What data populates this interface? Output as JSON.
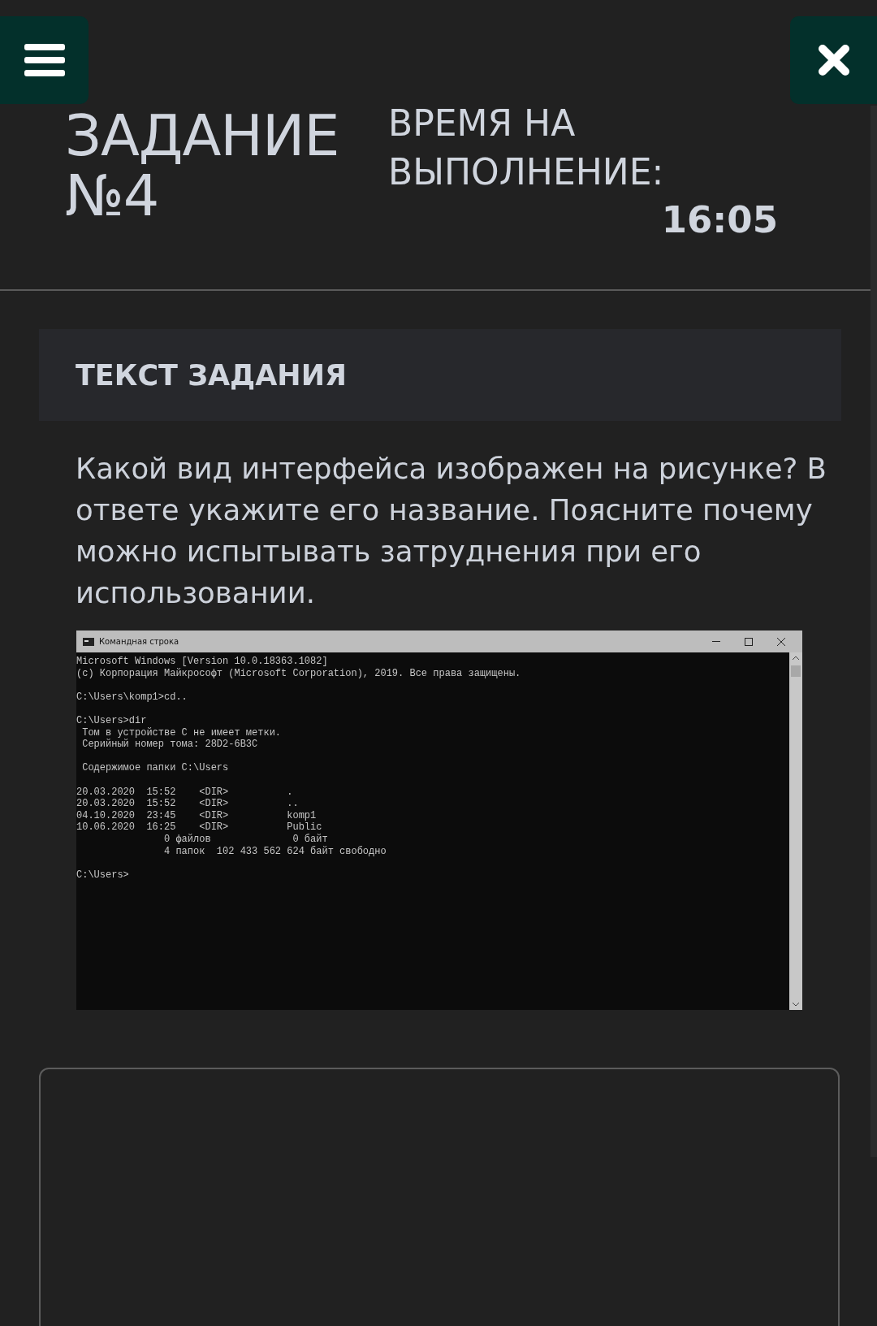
{
  "header": {
    "task_title": "ЗАДАНИЕ №4",
    "timer_label": "ВРЕМЯ НА ВЫПОЛНЕНИЕ:",
    "timer_value": "16:05"
  },
  "task": {
    "heading": "ТЕКСТ ЗАДАНИЯ",
    "question": "Какой вид интерфейса изображен на рисунке? В ответе укажите его название. Поясните почему можно испытывать затруднения при его использовании.",
    "screenshot": {
      "title": "Командная строка",
      "blocks": [
        [
          "Microsoft Windows [Version 10.0.18363.1082]",
          "(c) Корпорация Майкрософт (Microsoft Corporation), 2019. Все права защищены."
        ],
        [
          "C:\\Users\\komp1>cd.."
        ],
        [
          "C:\\Users>dir",
          " Том в устройстве C не имеет метки.",
          " Серийный номер тома: 28D2-6B3C"
        ],
        [
          " Содержимое папки C:\\Users"
        ],
        [
          "20.03.2020  15:52    <DIR>          .",
          "20.03.2020  15:52    <DIR>          ..",
          "04.10.2020  23:45    <DIR>          komp1",
          "10.06.2020  16:25    <DIR>          Public",
          "               0 файлов              0 байт",
          "               4 папок  102 433 562 624 байт свободно"
        ],
        [
          "C:\\Users>"
        ]
      ]
    }
  },
  "answer": {
    "kind": "textarea"
  }
}
